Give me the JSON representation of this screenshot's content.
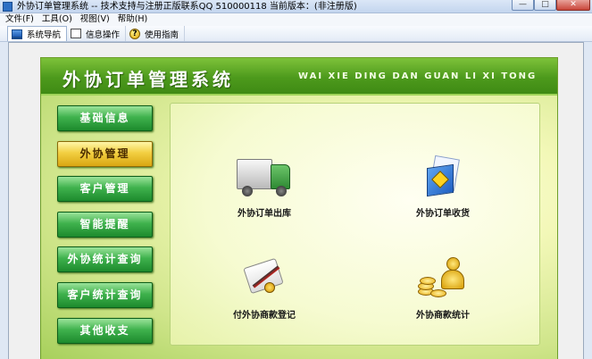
{
  "window": {
    "title": "外协订单管理系统 -- 技术支持与注册正版联系QQ 510000118    当前版本：(非注册版)",
    "minimize": "—",
    "maximize": "□",
    "close": "✕"
  },
  "menu": {
    "items": [
      "文件(F)",
      "工具(O)",
      "视图(V)",
      "帮助(H)"
    ]
  },
  "toolbar": {
    "tabs": [
      {
        "label": "系统导航",
        "icon": "monitor-icon"
      },
      {
        "label": "信息操作",
        "icon": "document-icon"
      },
      {
        "label": "使用指南",
        "icon": "help-icon",
        "glyph": "?"
      }
    ]
  },
  "banner": {
    "title": "外协订单管理系统",
    "subtitle": "WAI XIE DING DAN GUAN LI XI TONG"
  },
  "nav": {
    "items": [
      "基础信息",
      "外协管理",
      "客户管理",
      "智能提醒",
      "外协统计查询",
      "客户统计查询",
      "其他收支"
    ],
    "active_index": 1
  },
  "tiles": [
    {
      "label": "外协订单出库",
      "icon": "truck-icon"
    },
    {
      "label": "外协订单收货",
      "icon": "folder-icon"
    },
    {
      "label": "付外协商款登记",
      "icon": "scroll-pen-icon"
    },
    {
      "label": "外协商款统计",
      "icon": "coins-person-icon"
    }
  ],
  "colors": {
    "banner_green": "#4d9a1c",
    "nav_green": "#3fb24d",
    "nav_active_gold": "#f2cf41"
  }
}
